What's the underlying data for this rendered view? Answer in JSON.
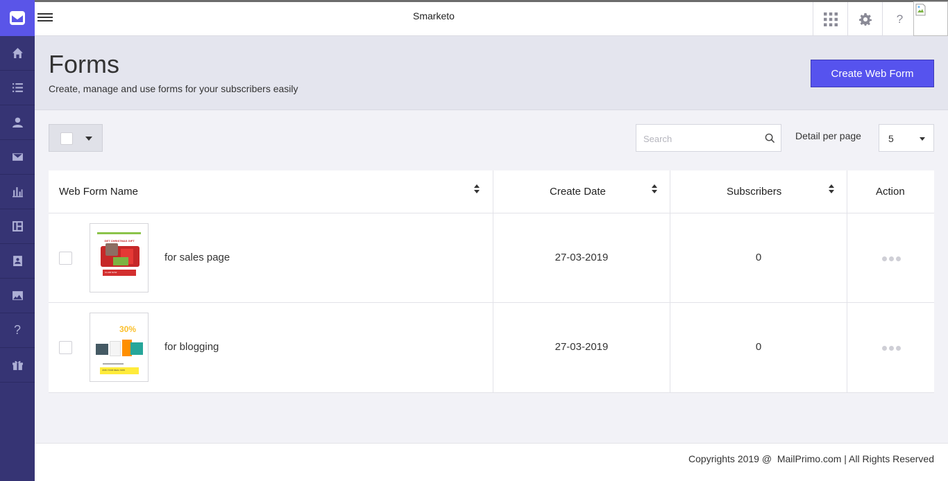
{
  "app": {
    "name": "Smarketo"
  },
  "page": {
    "title": "Forms",
    "subtitle": "Create, manage and use forms for your subscribers easily",
    "create_button": "Create Web Form"
  },
  "toolbar": {
    "search_placeholder": "Search",
    "per_page_label": "Detail per page",
    "per_page_value": "5"
  },
  "table": {
    "columns": [
      "Web Form Name",
      "Create Date",
      "Subscribers",
      "Action"
    ],
    "rows": [
      {
        "name": "for sales page",
        "date": "27-03-2019",
        "subscribers": "0",
        "thumb_top": "GET CHRISTMAS GIFT",
        "thumb_cta": "CLAIM NOW"
      },
      {
        "name": "for blogging",
        "date": "27-03-2019",
        "subscribers": "0",
        "thumb_top": "30%",
        "thumb_cta": "JOIN YOUR DEAL NOW"
      }
    ]
  },
  "footer": {
    "text": "Copyrights 2019 @  MailPrimo.com | All Rights Reserved"
  },
  "sidebar": {
    "items": [
      "home-icon",
      "list-icon",
      "user-icon",
      "mail-icon",
      "chart-icon",
      "layout-icon",
      "contact-book-icon",
      "image-icon",
      "help-icon",
      "gift-icon"
    ]
  },
  "colors": {
    "sidebar": "#363474",
    "accent": "#5653ee",
    "logo_bg": "#5a55e8"
  }
}
